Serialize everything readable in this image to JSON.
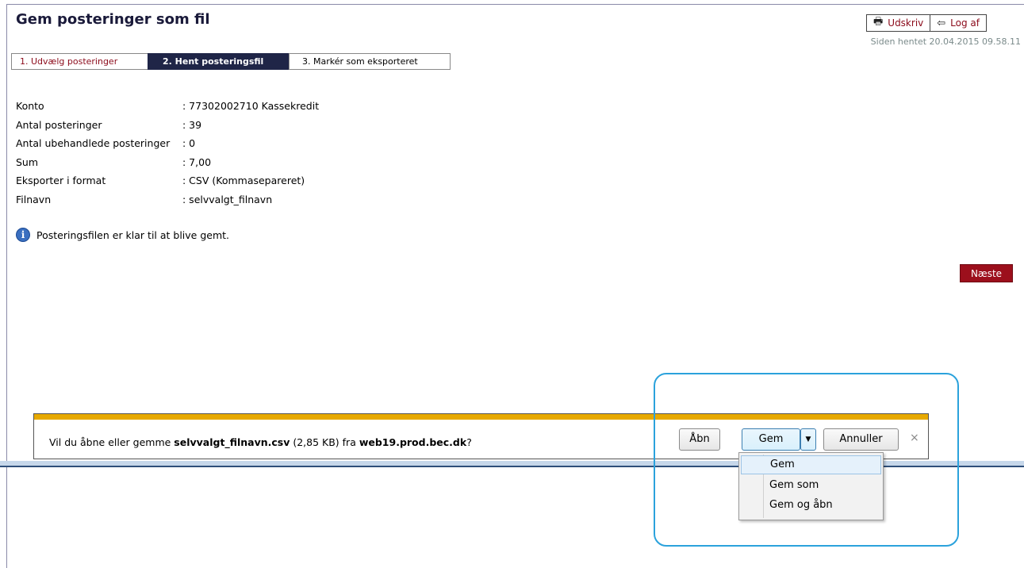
{
  "header": {
    "title": "Gem posteringer som fil",
    "print_label": "Udskriv",
    "logout_label": "Log af",
    "loaded_text": "Siden hentet 20.04.2015 09.58.11"
  },
  "steps": [
    {
      "label": "1. Udvælg posteringer"
    },
    {
      "label": "2. Hent posteringsfil"
    },
    {
      "label": "3. Markér som eksporteret"
    }
  ],
  "details": [
    {
      "label": "Konto",
      "value": ": 77302002710 Kassekredit"
    },
    {
      "label": "Antal posteringer",
      "value": ": 39"
    },
    {
      "label": "Antal ubehandlede posteringer",
      "value": ": 0"
    },
    {
      "label": "Sum",
      "value": ": 7,00"
    },
    {
      "label": "Eksporter i format",
      "value": ": CSV (Kommasepareret)"
    },
    {
      "label": "Filnavn",
      "value": ": selvvalgt_filnavn"
    }
  ],
  "notice": "Posteringsfilen er klar til at blive gemt.",
  "next_label": "Næste",
  "download": {
    "prefix": "Vil du åbne eller gemme ",
    "filename": "selvvalgt_filnavn.csv",
    "size": " (2,85 KB) fra ",
    "host": "web19.prod.bec.dk",
    "suffix": "?",
    "open_label": "Åbn",
    "save_label": "Gem",
    "cancel_label": "Annuller",
    "close_glyph": "×",
    "menu": [
      "Gem",
      "Gem som",
      "Gem og åbn"
    ]
  },
  "colors": {
    "accent": "#9c0f1c",
    "step_active": "#1f2547",
    "download_stripe": "#e7a900",
    "highlight": "#2ba2dc"
  }
}
